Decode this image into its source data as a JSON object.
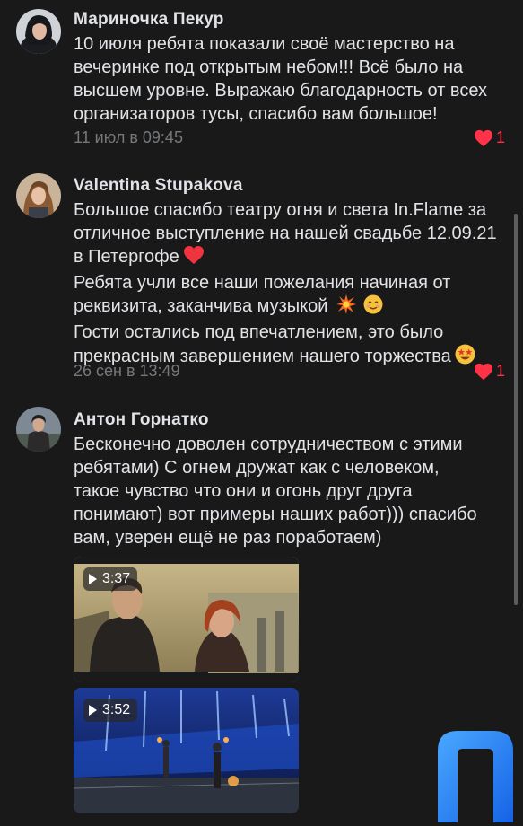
{
  "comments": [
    {
      "author": "Мариночка Пекур",
      "lines": [
        "10 июля ребята показали своё мастерство на",
        "вечеринке под открытым небом!!! Всё было на",
        "высшем уровне. Выражаю благодарность от всех",
        "организаторов тусы, спасибо вам большое!"
      ],
      "date": "11 июл в 09:45",
      "likes": "1"
    },
    {
      "author": "Valentina Stupakova",
      "lines": [
        "Большое спасибо театру огня и света In.Flame за",
        "отличное выступление на нашей свадьбе 12.09.21",
        "в Петергофе",
        "Ребята учли все наши пожелания начиная от",
        "реквизита, заканчива музыкой",
        "Гости остались под впечатлением, это было",
        "прекрасным завершением нашего торжества"
      ],
      "date": "26 сен в 13:49",
      "likes": "1"
    },
    {
      "author": "Антон Горнатко",
      "lines": [
        "Бесконечно доволен сотрудничеством с этими",
        "ребятами) С огнем дружат как с человеком,",
        "такое чувство что они и огонь друг друга",
        "понимают) вот примеры наших работ))) спасибо",
        "вам, уверен ещё не раз поработаем)"
      ],
      "videos": [
        {
          "duration": "3:37"
        },
        {
          "duration": "3:52"
        }
      ]
    }
  ],
  "icons": {
    "like": "heart-icon",
    "play": "play-icon",
    "emoji_heart": "red-heart-emoji",
    "emoji_collision": "collision-emoji",
    "emoji_smile": "smiling-face-emoji",
    "emoji_starstruck": "star-struck-emoji"
  },
  "colors": {
    "background": "#19191a",
    "text": "#e1e3e6",
    "secondary": "#76787a",
    "like": "#ff3347",
    "brand_blue": "#1e7bff"
  }
}
